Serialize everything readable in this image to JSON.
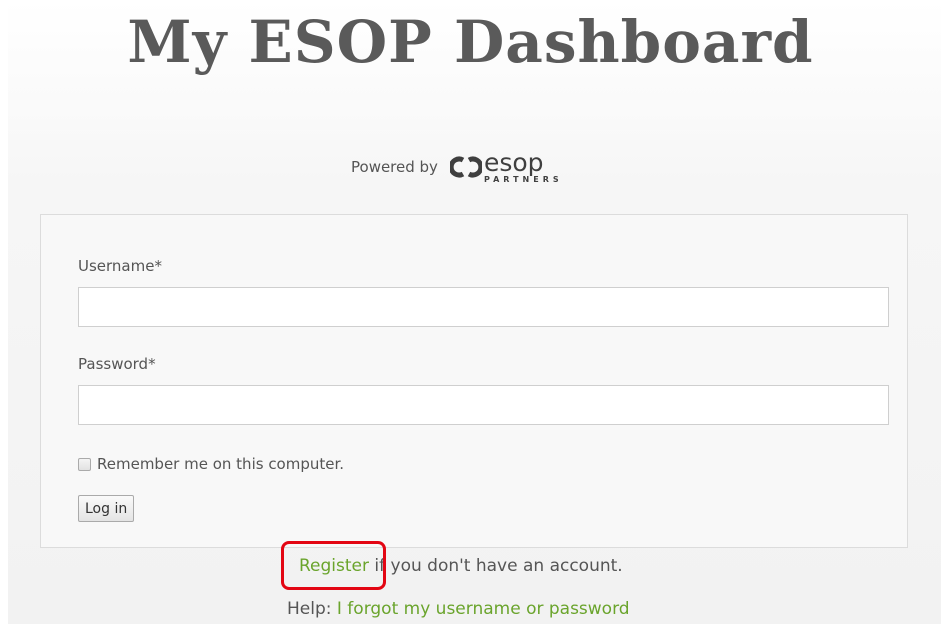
{
  "header": {
    "title": "My ESOP Dashboard",
    "powered_by": "Powered by",
    "logo_text": "esop",
    "logo_subtext": "PARTNERS"
  },
  "form": {
    "username_label": "Username*",
    "username_value": "",
    "password_label": "Password*",
    "password_value": "",
    "remember_checked": false,
    "remember_label": "Remember me on this computer.",
    "login_label": "Log in"
  },
  "footer": {
    "register_link": "Register",
    "register_rest": " if you don't have an account.",
    "help_prefix": "Help: ",
    "forgot_link": "I forgot my username or password"
  },
  "colors": {
    "link": "#6aa42c",
    "highlight": "#e30613",
    "title": "#5a5a5a"
  },
  "icons": {
    "logo": "esop-partners-logo",
    "checkbox": "checkbox-unchecked"
  }
}
